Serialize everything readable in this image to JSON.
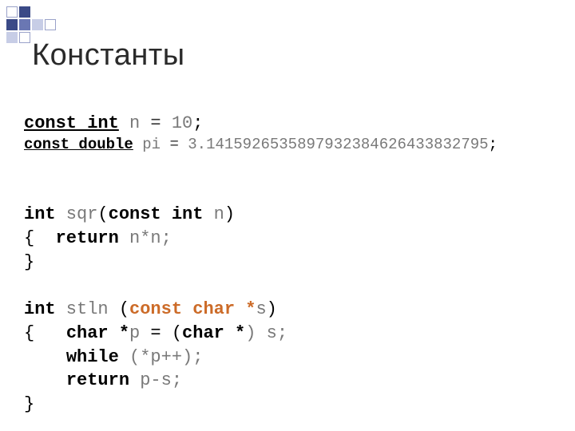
{
  "title": "Константы",
  "code": {
    "l1": {
      "kw1": "const int",
      "id": " n",
      "op": " = ",
      "lit": "10",
      "semi": ";"
    },
    "l2": {
      "kw1": "const double",
      "id": " pi",
      "op": " = ",
      "lit": "3.1415926535897932384626433832795",
      "semi": ";"
    },
    "l4": {
      "kw1": "int",
      "id": " sqr",
      "paren_o": "(",
      "kw2": "const int",
      "id2": " n",
      "paren_c": ")"
    },
    "l5": {
      "brace_o": "{  ",
      "kw": "return",
      "expr": " n*n;"
    },
    "l6": {
      "brace_c": "}"
    },
    "l8": {
      "kw1": "int",
      "id": " stln ",
      "paren_o": "(",
      "kw_red": "const char *",
      "id2": "s",
      "paren_c": ")"
    },
    "l9": {
      "brace_o": "{   ",
      "kw": "char *",
      "id": "p",
      "op": " = (",
      "kw2": "char *",
      "rest": ") s;"
    },
    "l10": {
      "pad": "    ",
      "kw": "while",
      "expr": " (*p++);"
    },
    "l11": {
      "pad": "    ",
      "kw": "return",
      "expr": " p-s;"
    },
    "l12": {
      "brace_c": "}"
    }
  }
}
